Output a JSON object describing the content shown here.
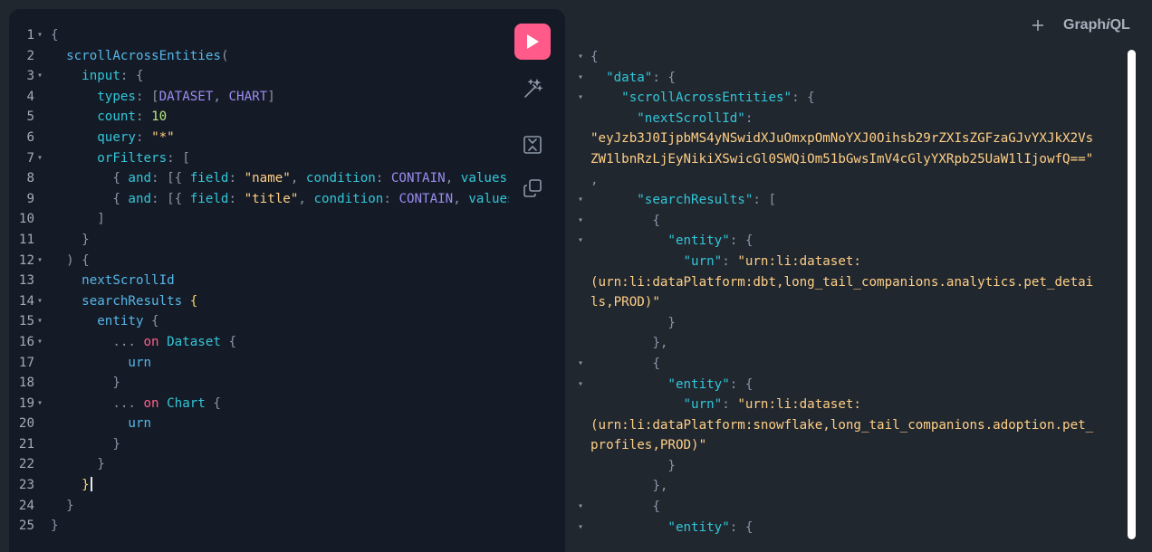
{
  "app": {
    "brand_prefix": "Graph",
    "brand_italic": "i",
    "brand_suffix": "QL"
  },
  "toolbar": {
    "run_icon": "play-icon",
    "prettify_icon": "magic-wand-icon",
    "merge_icon": "merge-fragments-icon",
    "copy_icon": "copy-icon"
  },
  "header": {
    "add_tab_label": "+"
  },
  "editor": {
    "lines": [
      {
        "n": "1",
        "fold": true,
        "tokens": [
          [
            "{",
            "punc"
          ]
        ]
      },
      {
        "n": "2",
        "fold": false,
        "tokens": [
          [
            "  ",
            "plain"
          ],
          [
            "scrollAcrossEntities",
            "field"
          ],
          [
            "(",
            "punc"
          ]
        ]
      },
      {
        "n": "3",
        "fold": true,
        "tokens": [
          [
            "    ",
            "plain"
          ],
          [
            "input",
            "key"
          ],
          [
            ": {",
            "punc"
          ]
        ]
      },
      {
        "n": "4",
        "fold": false,
        "tokens": [
          [
            "      ",
            "plain"
          ],
          [
            "types",
            "key"
          ],
          [
            ": [",
            "punc"
          ],
          [
            "DATASET",
            "type"
          ],
          [
            ", ",
            "punc"
          ],
          [
            "CHART",
            "type"
          ],
          [
            "]",
            "punc"
          ]
        ]
      },
      {
        "n": "5",
        "fold": false,
        "tokens": [
          [
            "      ",
            "plain"
          ],
          [
            "count",
            "key"
          ],
          [
            ": ",
            "punc"
          ],
          [
            "10",
            "num"
          ]
        ]
      },
      {
        "n": "6",
        "fold": false,
        "tokens": [
          [
            "      ",
            "plain"
          ],
          [
            "query",
            "key"
          ],
          [
            ": ",
            "punc"
          ],
          [
            "\"*\"",
            "str"
          ]
        ]
      },
      {
        "n": "7",
        "fold": true,
        "tokens": [
          [
            "      ",
            "plain"
          ],
          [
            "orFilters",
            "key"
          ],
          [
            ": [",
            "punc"
          ]
        ]
      },
      {
        "n": "8",
        "fold": false,
        "tokens": [
          [
            "        { ",
            "punc"
          ],
          [
            "and",
            "key"
          ],
          [
            ": [{ ",
            "punc"
          ],
          [
            "field",
            "key"
          ],
          [
            ": ",
            "punc"
          ],
          [
            "\"name\"",
            "str"
          ],
          [
            ", ",
            "punc"
          ],
          [
            "condition",
            "key"
          ],
          [
            ": ",
            "punc"
          ],
          [
            "CONTAIN",
            "type"
          ],
          [
            ", ",
            "punc"
          ],
          [
            "values",
            "key"
          ]
        ]
      },
      {
        "n": "9",
        "fold": false,
        "tokens": [
          [
            "        { ",
            "punc"
          ],
          [
            "and",
            "key"
          ],
          [
            ": [{ ",
            "punc"
          ],
          [
            "field",
            "key"
          ],
          [
            ": ",
            "punc"
          ],
          [
            "\"title\"",
            "str"
          ],
          [
            ", ",
            "punc"
          ],
          [
            "condition",
            "key"
          ],
          [
            ": ",
            "punc"
          ],
          [
            "CONTAIN",
            "type"
          ],
          [
            ", ",
            "punc"
          ],
          [
            "values",
            "key"
          ]
        ]
      },
      {
        "n": "10",
        "fold": false,
        "tokens": [
          [
            "      ]",
            "punc"
          ]
        ]
      },
      {
        "n": "11",
        "fold": false,
        "tokens": [
          [
            "    }",
            "punc"
          ]
        ]
      },
      {
        "n": "12",
        "fold": true,
        "tokens": [
          [
            "  ) {",
            "punc"
          ]
        ]
      },
      {
        "n": "13",
        "fold": false,
        "tokens": [
          [
            "    ",
            "plain"
          ],
          [
            "nextScrollId",
            "field"
          ]
        ]
      },
      {
        "n": "14",
        "fold": true,
        "tokens": [
          [
            "    ",
            "plain"
          ],
          [
            "searchResults",
            "field"
          ],
          [
            " ",
            "plain"
          ],
          [
            "{",
            "bright"
          ]
        ]
      },
      {
        "n": "15",
        "fold": true,
        "tokens": [
          [
            "      ",
            "plain"
          ],
          [
            "entity",
            "field"
          ],
          [
            " {",
            "punc"
          ]
        ]
      },
      {
        "n": "16",
        "fold": true,
        "tokens": [
          [
            "        ... ",
            "punc"
          ],
          [
            "on",
            "kw"
          ],
          [
            " ",
            "plain"
          ],
          [
            "Dataset",
            "key"
          ],
          [
            " {",
            "punc"
          ]
        ]
      },
      {
        "n": "17",
        "fold": false,
        "tokens": [
          [
            "          ",
            "plain"
          ],
          [
            "urn",
            "field"
          ]
        ]
      },
      {
        "n": "18",
        "fold": false,
        "tokens": [
          [
            "        }",
            "punc"
          ]
        ]
      },
      {
        "n": "19",
        "fold": true,
        "tokens": [
          [
            "        ... ",
            "punc"
          ],
          [
            "on",
            "kw"
          ],
          [
            " ",
            "plain"
          ],
          [
            "Chart",
            "key"
          ],
          [
            " {",
            "punc"
          ]
        ]
      },
      {
        "n": "20",
        "fold": false,
        "tokens": [
          [
            "          ",
            "plain"
          ],
          [
            "urn",
            "field"
          ]
        ]
      },
      {
        "n": "21",
        "fold": false,
        "tokens": [
          [
            "        }",
            "punc"
          ]
        ]
      },
      {
        "n": "22",
        "fold": false,
        "tokens": [
          [
            "      }",
            "punc"
          ]
        ]
      },
      {
        "n": "23",
        "fold": false,
        "tokens": [
          [
            "    ",
            "plain"
          ],
          [
            "}",
            "bright"
          ]
        ],
        "cursor": true
      },
      {
        "n": "24",
        "fold": false,
        "tokens": [
          [
            "  }",
            "punc"
          ]
        ]
      },
      {
        "n": "25",
        "fold": false,
        "tokens": [
          [
            "}",
            "punc"
          ]
        ]
      }
    ]
  },
  "results": {
    "lines": [
      {
        "fold": true,
        "tokens": [
          [
            "{",
            "punc"
          ]
        ]
      },
      {
        "fold": true,
        "tokens": [
          [
            "  ",
            "plain"
          ],
          [
            "\"data\"",
            "key"
          ],
          [
            ": {",
            "punc"
          ]
        ]
      },
      {
        "fold": true,
        "tokens": [
          [
            "    ",
            "plain"
          ],
          [
            "\"scrollAcrossEntities\"",
            "key"
          ],
          [
            ": {",
            "punc"
          ]
        ]
      },
      {
        "fold": false,
        "tokens": [
          [
            "      ",
            "plain"
          ],
          [
            "\"nextScrollId\"",
            "key"
          ],
          [
            ":",
            "punc"
          ]
        ]
      },
      {
        "fold": false,
        "tokens": [
          [
            "\"eyJzb3J0IjpbMS4yNSwidXJuOmxpOmNoYXJ0Oihsb29rZXIsZGFzaGJvYXJkX2Vs",
            "str"
          ]
        ]
      },
      {
        "fold": false,
        "tokens": [
          [
            "ZW1lbnRzLjEyNikiXSwicGl0SWQiOm51bGwsImV4cGlyYXRpb25UaW1lIjowfQ==\"",
            "str"
          ]
        ]
      },
      {
        "fold": false,
        "tokens": [
          [
            ",",
            "punc"
          ]
        ]
      },
      {
        "fold": true,
        "tokens": [
          [
            "      ",
            "plain"
          ],
          [
            "\"searchResults\"",
            "key"
          ],
          [
            ": [",
            "punc"
          ]
        ]
      },
      {
        "fold": true,
        "tokens": [
          [
            "        {",
            "punc"
          ]
        ]
      },
      {
        "fold": true,
        "tokens": [
          [
            "          ",
            "plain"
          ],
          [
            "\"entity\"",
            "key"
          ],
          [
            ": {",
            "punc"
          ]
        ]
      },
      {
        "fold": false,
        "tokens": [
          [
            "            ",
            "plain"
          ],
          [
            "\"urn\"",
            "key"
          ],
          [
            ": ",
            "punc"
          ],
          [
            "\"urn:li:dataset:",
            "str"
          ]
        ]
      },
      {
        "fold": false,
        "tokens": [
          [
            "(urn:li:dataPlatform:dbt,long_tail_companions.analytics.pet_detai",
            "str"
          ]
        ]
      },
      {
        "fold": false,
        "tokens": [
          [
            "ls,PROD)\"",
            "str"
          ]
        ]
      },
      {
        "fold": false,
        "tokens": [
          [
            "          }",
            "punc"
          ]
        ]
      },
      {
        "fold": false,
        "tokens": [
          [
            "        },",
            "punc"
          ]
        ]
      },
      {
        "fold": true,
        "tokens": [
          [
            "        {",
            "punc"
          ]
        ]
      },
      {
        "fold": true,
        "tokens": [
          [
            "          ",
            "plain"
          ],
          [
            "\"entity\"",
            "key"
          ],
          [
            ": {",
            "punc"
          ]
        ]
      },
      {
        "fold": false,
        "tokens": [
          [
            "            ",
            "plain"
          ],
          [
            "\"urn\"",
            "key"
          ],
          [
            ": ",
            "punc"
          ],
          [
            "\"urn:li:dataset:",
            "str"
          ]
        ]
      },
      {
        "fold": false,
        "tokens": [
          [
            "(urn:li:dataPlatform:snowflake,long_tail_companions.adoption.pet_",
            "str"
          ]
        ]
      },
      {
        "fold": false,
        "tokens": [
          [
            "profiles,PROD)\"",
            "str"
          ]
        ]
      },
      {
        "fold": false,
        "tokens": [
          [
            "          }",
            "punc"
          ]
        ]
      },
      {
        "fold": false,
        "tokens": [
          [
            "        },",
            "punc"
          ]
        ]
      },
      {
        "fold": true,
        "tokens": [
          [
            "        {",
            "punc"
          ]
        ]
      },
      {
        "fold": true,
        "tokens": [
          [
            "          ",
            "plain"
          ],
          [
            "\"entity\"",
            "key"
          ],
          [
            ": {",
            "punc"
          ]
        ]
      }
    ]
  }
}
